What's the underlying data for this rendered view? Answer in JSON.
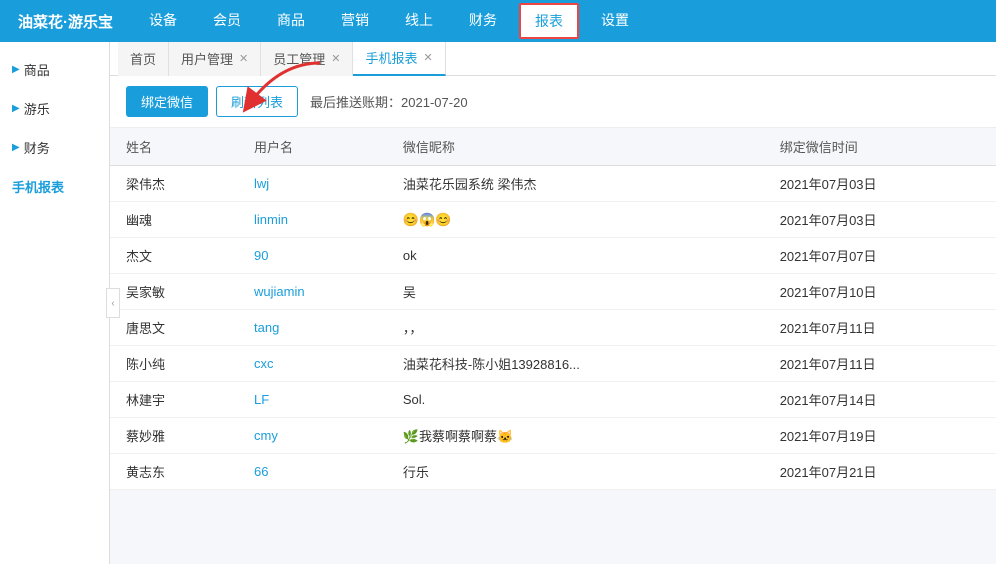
{
  "app": {
    "logo": "油菜花·游乐宝"
  },
  "topnav": {
    "items": [
      {
        "label": "设备",
        "active": false
      },
      {
        "label": "会员",
        "active": false
      },
      {
        "label": "商品",
        "active": false
      },
      {
        "label": "营销",
        "active": false
      },
      {
        "label": "线上",
        "active": false
      },
      {
        "label": "财务",
        "active": false
      },
      {
        "label": "报表",
        "active": true
      },
      {
        "label": "设置",
        "active": false
      }
    ]
  },
  "sidebar": {
    "items": [
      {
        "label": "商品",
        "active": false
      },
      {
        "label": "游乐",
        "active": false
      },
      {
        "label": "财务",
        "active": false
      },
      {
        "label": "手机报表",
        "active": true
      }
    ]
  },
  "tabs": [
    {
      "label": "首页",
      "closable": false,
      "active": false
    },
    {
      "label": "用户管理",
      "closable": true,
      "active": false
    },
    {
      "label": "员工管理",
      "closable": true,
      "active": false
    },
    {
      "label": "手机报表",
      "closable": true,
      "active": true
    }
  ],
  "toolbar": {
    "bind_wechat": "绑定微信",
    "refresh_list": "刷新列表",
    "last_push_label": "最后推送账期：",
    "last_push_date": "2021-07-20"
  },
  "table": {
    "headers": [
      "姓名",
      "用户名",
      "微信昵称",
      "绑定微信时间"
    ],
    "rows": [
      {
        "name": "梁伟杰",
        "username": "lwj",
        "wechat_nick": "油菜花乐园系统 梁伟杰",
        "bind_time": "2021年07月03日"
      },
      {
        "name": "幽魂",
        "username": "linmin",
        "wechat_nick": "😊😱😊",
        "bind_time": "2021年07月03日"
      },
      {
        "name": "杰文",
        "username": "90",
        "wechat_nick": "ok",
        "bind_time": "2021年07月07日"
      },
      {
        "name": "吴家敏",
        "username": "wujiamin",
        "wechat_nick": "吴",
        "bind_time": "2021年07月10日"
      },
      {
        "name": "唐思文",
        "username": "tang",
        "wechat_nick": "，，",
        "bind_time": "2021年07月11日"
      },
      {
        "name": "陈小纯",
        "username": "cxc",
        "wechat_nick": "油菜花科技-陈小姐13928816...",
        "bind_time": "2021年07月11日"
      },
      {
        "name": "林建宇",
        "username": "LF",
        "wechat_nick": "Sol.",
        "bind_time": "2021年07月14日"
      },
      {
        "name": "蔡妙雅",
        "username": "cmy",
        "wechat_nick": "🌿我蔡啊蔡啊蔡🐱",
        "bind_time": "2021年07月19日"
      },
      {
        "name": "黄志东",
        "username": "66",
        "wechat_nick": "行乐",
        "bind_time": "2021年07月21日"
      }
    ]
  }
}
